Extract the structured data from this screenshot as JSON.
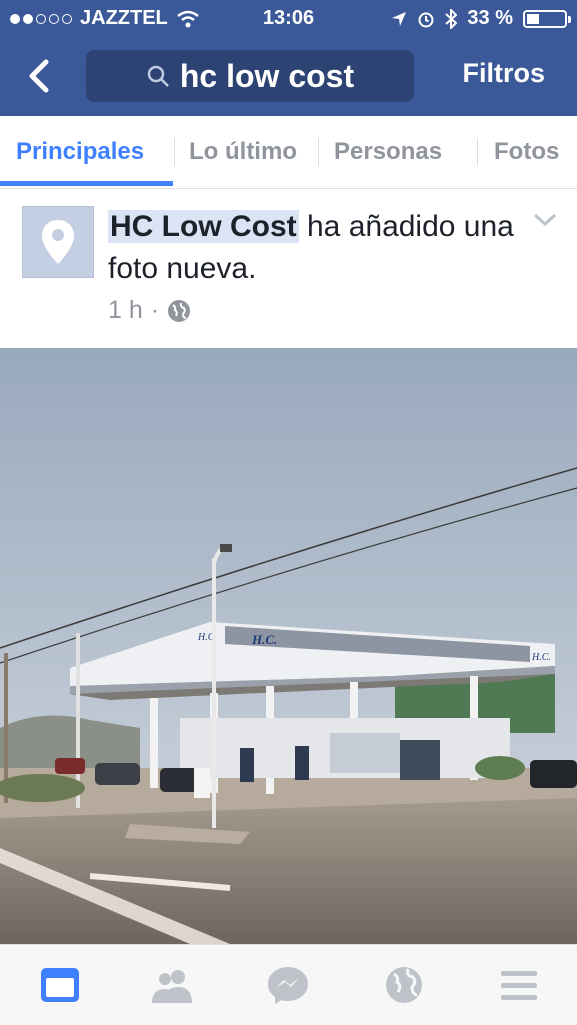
{
  "status_bar": {
    "carrier": "JAZZTEL",
    "time": "13:06",
    "battery": "33 %",
    "battery_level": 0.33,
    "signal_bars": 2
  },
  "nav": {
    "search_query": "hc low cost",
    "filters_label": "Filtros"
  },
  "tabs": [
    {
      "label": "Principales",
      "active": true
    },
    {
      "label": "Lo último",
      "active": false
    },
    {
      "label": "Personas",
      "active": false
    },
    {
      "label": "Fotos",
      "active": false
    }
  ],
  "post": {
    "author": "HC Low Cost",
    "action": " ha añadido una foto nueva.",
    "time": "1 h",
    "separator": "·",
    "privacy_icon": "globe-icon",
    "photo_sign_large": "H.C.",
    "photo_sign_small": "H.C",
    "photo_sign_right": "H.C."
  },
  "bottom_nav": [
    {
      "name": "news-feed",
      "icon": "news-feed-icon",
      "active": true
    },
    {
      "name": "friends",
      "icon": "friends-icon",
      "active": false
    },
    {
      "name": "messenger",
      "icon": "messenger-icon",
      "active": false
    },
    {
      "name": "notifications",
      "icon": "globe-icon",
      "active": false
    },
    {
      "name": "more",
      "icon": "menu-icon",
      "active": false
    }
  ],
  "colors": {
    "brand": "#3b5998",
    "active_tab": "#4080ff",
    "highlight": "#dbe4f4",
    "muted": "#90949c"
  }
}
